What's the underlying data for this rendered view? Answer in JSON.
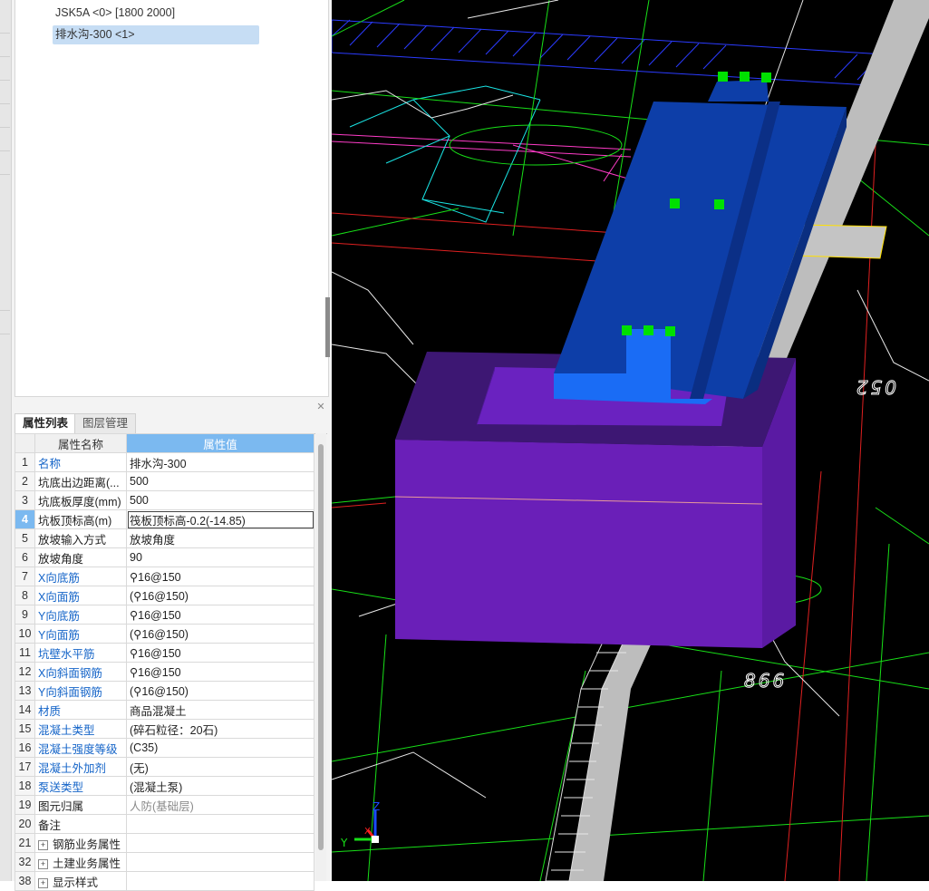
{
  "tree": {
    "items": [
      {
        "label": "JSK5A <0> [1800 2000]",
        "selected": false
      },
      {
        "label": "排水沟-300 <1>",
        "selected": true
      }
    ]
  },
  "tabs": [
    {
      "label": "属性列表",
      "active": true
    },
    {
      "label": "图层管理",
      "active": false
    }
  ],
  "table": {
    "headers": {
      "name": "属性名称",
      "value": "属性值"
    },
    "rows": [
      {
        "num": "1",
        "name": "名称",
        "value": "排水沟-300",
        "name_style": "blue"
      },
      {
        "num": "2",
        "name": "坑底出边距离(...",
        "value": "500",
        "name_style": "black"
      },
      {
        "num": "3",
        "name": "坑底板厚度(mm)",
        "value": "500",
        "name_style": "black"
      },
      {
        "num": "4",
        "name": "坑板顶标高(m)",
        "value": "筏板顶标高-0.2(-14.85)",
        "name_style": "black",
        "active": true
      },
      {
        "num": "5",
        "name": "放坡输入方式",
        "value": "放坡角度",
        "name_style": "black"
      },
      {
        "num": "6",
        "name": "放坡角度",
        "value": "90",
        "name_style": "black"
      },
      {
        "num": "7",
        "name": "X向底筋",
        "value": "⚲16@150",
        "name_style": "blue"
      },
      {
        "num": "8",
        "name": "X向面筋",
        "value": "(⚲16@150)",
        "name_style": "blue"
      },
      {
        "num": "9",
        "name": "Y向底筋",
        "value": "⚲16@150",
        "name_style": "blue"
      },
      {
        "num": "10",
        "name": "Y向面筋",
        "value": "(⚲16@150)",
        "name_style": "blue"
      },
      {
        "num": "11",
        "name": "坑壁水平筋",
        "value": "⚲16@150",
        "name_style": "blue"
      },
      {
        "num": "12",
        "name": "X向斜面钢筋",
        "value": "⚲16@150",
        "name_style": "blue"
      },
      {
        "num": "13",
        "name": "Y向斜面钢筋",
        "value": "(⚲16@150)",
        "name_style": "blue"
      },
      {
        "num": "14",
        "name": "材质",
        "value": "商品混凝土",
        "name_style": "blue"
      },
      {
        "num": "15",
        "name": "混凝土类型",
        "value": "(碎石粒径：20石)",
        "name_style": "blue"
      },
      {
        "num": "16",
        "name": "混凝土强度等级",
        "value": "(C35)",
        "name_style": "blue"
      },
      {
        "num": "17",
        "name": "混凝土外加剂",
        "value": "(无)",
        "name_style": "blue"
      },
      {
        "num": "18",
        "name": "泵送类型",
        "value": "(混凝土泵)",
        "name_style": "blue"
      },
      {
        "num": "19",
        "name": "图元归属",
        "value": "人防(基础层)",
        "name_style": "black",
        "value_style": "gray"
      },
      {
        "num": "20",
        "name": "备注",
        "value": "",
        "name_style": "black"
      },
      {
        "num": "21",
        "name": "钢筋业务属性",
        "value": "",
        "name_style": "black",
        "group": true
      },
      {
        "num": "32",
        "name": "土建业务属性",
        "value": "",
        "name_style": "black",
        "group": true
      },
      {
        "num": "38",
        "name": "显示样式",
        "value": "",
        "name_style": "black",
        "group": true
      }
    ]
  },
  "viewport": {
    "dimension_labels": [
      "052",
      "866"
    ],
    "axis_labels": {
      "x": "X",
      "y": "Y",
      "z": "Z"
    },
    "colors": {
      "background": "#000000",
      "pit_purple": "#6a1fb8",
      "trench_blue": "#0d3ea8",
      "highlight_blue": "#1a6cf5",
      "grip_green": "#00ff00"
    }
  }
}
